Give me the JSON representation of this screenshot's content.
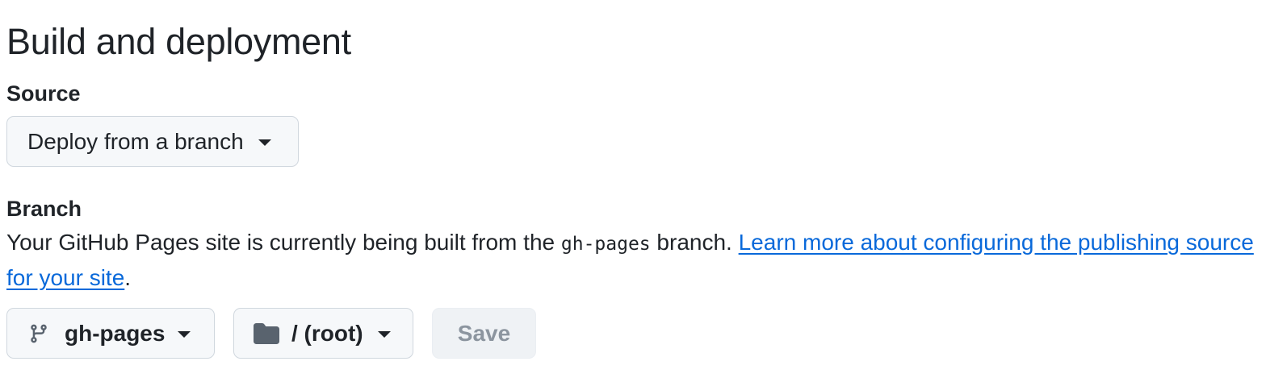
{
  "page": {
    "title": "Build and deployment"
  },
  "source": {
    "label": "Source",
    "selected": "Deploy from a branch",
    "caret_icon": "triangle-down-icon"
  },
  "branch": {
    "label": "Branch",
    "description_prefix": "Your GitHub Pages site is currently being built from the ",
    "branch_code": "gh-pages",
    "description_middle": " branch. ",
    "learn_more_link": "Learn more about configuring the publishing source for your site",
    "description_suffix": ".",
    "branch_select": {
      "icon": "git-branch-icon",
      "value": "gh-pages"
    },
    "folder_select": {
      "icon": "folder-icon",
      "value": "/ (root)"
    },
    "save_label": "Save"
  },
  "colors": {
    "text": "#1f2328",
    "link": "#0969da",
    "button_bg": "#f6f8fa",
    "button_border": "#d0d7de",
    "disabled_text": "#8c959f",
    "icon": "#59636e"
  }
}
